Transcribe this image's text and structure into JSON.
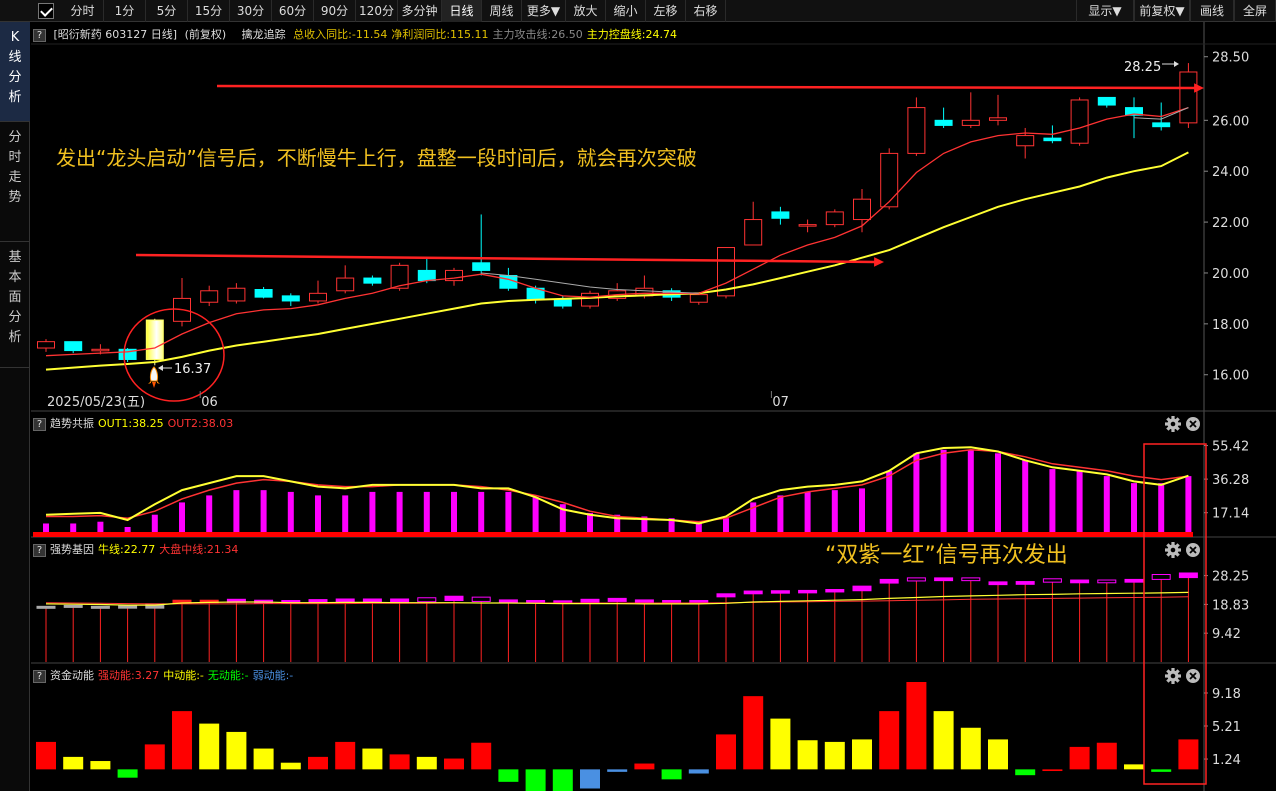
{
  "toolbar": {
    "checked": true,
    "buttons": [
      "分时",
      "1分",
      "5分",
      "15分",
      "30分",
      "60分",
      "90分",
      "120分",
      "多分钟",
      "日线",
      "周线",
      "更多▼",
      "放大",
      "缩小",
      "左移",
      "右移"
    ],
    "active": "日线",
    "right_buttons": [
      "显示▼",
      "前复权▼",
      "画线",
      "全屏"
    ]
  },
  "left_tabs": [
    {
      "label": "K线分析",
      "active": true
    },
    {
      "label": "分时走势",
      "active": false
    },
    {
      "label": "基本面分析",
      "active": false
    }
  ],
  "main_header": {
    "stock": "[昭衍新药 603127 日线]",
    "adj": "(前复权)",
    "indicator": "擒龙追踪",
    "items": [
      {
        "text": "总收入同比:-11.54",
        "color": "#e0c000"
      },
      {
        "text": "净利润同比:115.11",
        "color": "#e0c000"
      },
      {
        "text": "主力攻击线:26.50",
        "color": "#888888"
      },
      {
        "text": "主力控盘线:24.74",
        "color": "#ffff00"
      }
    ]
  },
  "annotations": {
    "main_text": "发出“龙头启动”信号后，不断慢牛上行，盘整一段时间后，就会再次突破",
    "sub_text": "“双紫一红”信号再次发出",
    "low_label": "16.37",
    "high_label": "28.25"
  },
  "x_labels": [
    {
      "text": "2025/05/23(五)",
      "index": 0
    },
    {
      "text": "06",
      "index": 6
    },
    {
      "text": "07",
      "index": 27
    }
  ],
  "colors": {
    "up": "#ff3333",
    "down": "#00ffff",
    "ma_fast": "#ff3333",
    "ma_slow": "#ffff33",
    "ma_mid": "#aaaaaa",
    "magenta": "#ff00ff",
    "red": "#ff0000",
    "yellow": "#ffff00",
    "green": "#00ff00",
    "blue": "#4a90e2"
  },
  "chart_data": [
    {
      "type": "candlestick",
      "title": "擒龙追踪",
      "ylim": [
        15.4,
        29.0
      ],
      "y_ticks": [
        16.0,
        18.0,
        20.0,
        22.0,
        24.0,
        26.0,
        28.5
      ],
      "y_tick_labels": [
        "16.00",
        "18.00",
        "20.00",
        "22.00",
        "24.00",
        "26.00",
        "28.50"
      ],
      "candles": [
        {
          "o": 17.05,
          "h": 17.4,
          "l": 16.9,
          "c": 17.3
        },
        {
          "o": 17.3,
          "h": 17.3,
          "l": 16.85,
          "c": 16.95
        },
        {
          "o": 16.95,
          "h": 17.2,
          "l": 16.8,
          "c": 17.0
        },
        {
          "o": 17.0,
          "h": 17.05,
          "l": 16.5,
          "c": 16.6
        },
        {
          "o": 16.6,
          "h": 18.2,
          "l": 16.37,
          "c": 18.15,
          "signal": true
        },
        {
          "o": 18.1,
          "h": 19.8,
          "l": 17.9,
          "c": 19.0
        },
        {
          "o": 18.85,
          "h": 19.5,
          "l": 18.7,
          "c": 19.3
        },
        {
          "o": 18.9,
          "h": 19.6,
          "l": 18.8,
          "c": 19.4
        },
        {
          "o": 19.35,
          "h": 19.45,
          "l": 19.0,
          "c": 19.05
        },
        {
          "o": 19.1,
          "h": 19.2,
          "l": 18.7,
          "c": 18.9
        },
        {
          "o": 18.9,
          "h": 19.7,
          "l": 18.8,
          "c": 19.2
        },
        {
          "o": 19.3,
          "h": 20.3,
          "l": 19.2,
          "c": 19.8
        },
        {
          "o": 19.8,
          "h": 19.9,
          "l": 19.5,
          "c": 19.6
        },
        {
          "o": 19.4,
          "h": 20.4,
          "l": 19.3,
          "c": 20.3
        },
        {
          "o": 20.1,
          "h": 20.6,
          "l": 19.6,
          "c": 19.7
        },
        {
          "o": 19.7,
          "h": 20.2,
          "l": 19.5,
          "c": 20.1
        },
        {
          "o": 20.4,
          "h": 22.3,
          "l": 19.9,
          "c": 20.1
        },
        {
          "o": 19.9,
          "h": 20.2,
          "l": 19.3,
          "c": 19.4
        },
        {
          "o": 19.4,
          "h": 19.5,
          "l": 18.8,
          "c": 18.95
        },
        {
          "o": 18.95,
          "h": 19.1,
          "l": 18.6,
          "c": 18.7
        },
        {
          "o": 18.7,
          "h": 19.3,
          "l": 18.6,
          "c": 19.2
        },
        {
          "o": 19.0,
          "h": 19.6,
          "l": 18.9,
          "c": 19.3
        },
        {
          "o": 19.1,
          "h": 19.9,
          "l": 19.0,
          "c": 19.4
        },
        {
          "o": 19.3,
          "h": 19.4,
          "l": 18.9,
          "c": 19.05
        },
        {
          "o": 18.85,
          "h": 19.2,
          "l": 18.75,
          "c": 19.15
        },
        {
          "o": 19.1,
          "h": 21.0,
          "l": 19.0,
          "c": 21.0
        },
        {
          "o": 21.1,
          "h": 22.8,
          "l": 21.1,
          "c": 22.1
        },
        {
          "o": 22.4,
          "h": 22.6,
          "l": 21.9,
          "c": 22.15
        },
        {
          "o": 21.85,
          "h": 22.1,
          "l": 21.6,
          "c": 21.9
        },
        {
          "o": 21.9,
          "h": 22.5,
          "l": 21.8,
          "c": 22.4
        },
        {
          "o": 22.1,
          "h": 23.3,
          "l": 21.6,
          "c": 22.9
        },
        {
          "o": 22.6,
          "h": 24.9,
          "l": 22.5,
          "c": 24.7
        },
        {
          "o": 24.7,
          "h": 26.9,
          "l": 24.6,
          "c": 26.5
        },
        {
          "o": 26.0,
          "h": 26.5,
          "l": 25.7,
          "c": 25.8
        },
        {
          "o": 25.8,
          "h": 27.1,
          "l": 25.7,
          "c": 26.0
        },
        {
          "o": 26.0,
          "h": 27.0,
          "l": 25.8,
          "c": 26.1
        },
        {
          "o": 25.0,
          "h": 25.7,
          "l": 24.5,
          "c": 25.4
        },
        {
          "o": 25.3,
          "h": 25.8,
          "l": 25.1,
          "c": 25.2
        },
        {
          "o": 25.1,
          "h": 26.9,
          "l": 25.0,
          "c": 26.8
        },
        {
          "o": 26.9,
          "h": 26.9,
          "l": 26.5,
          "c": 26.6
        },
        {
          "o": 26.5,
          "h": 26.9,
          "l": 25.3,
          "c": 26.2
        },
        {
          "o": 25.9,
          "h": 26.7,
          "l": 25.6,
          "c": 25.75
        },
        {
          "o": 25.9,
          "h": 28.25,
          "l": 25.7,
          "c": 27.9
        }
      ],
      "ma_fast": [
        16.75,
        16.8,
        16.85,
        16.9,
        17.05,
        17.6,
        18.05,
        18.4,
        18.55,
        18.6,
        18.75,
        19.0,
        19.2,
        19.5,
        19.7,
        19.8,
        19.95,
        19.75,
        19.4,
        19.1,
        19.05,
        19.15,
        19.2,
        19.2,
        19.2,
        19.6,
        20.15,
        20.7,
        21.1,
        21.4,
        21.85,
        22.8,
        23.95,
        24.7,
        25.15,
        25.4,
        25.5,
        25.45,
        25.7,
        26.05,
        26.25,
        26.15,
        26.5
      ],
      "ma_slow": [
        16.2,
        16.28,
        16.36,
        16.42,
        16.5,
        16.7,
        16.95,
        17.15,
        17.3,
        17.45,
        17.6,
        17.8,
        18.0,
        18.2,
        18.4,
        18.6,
        18.8,
        18.9,
        18.95,
        18.98,
        19.02,
        19.08,
        19.12,
        19.16,
        19.2,
        19.35,
        19.55,
        19.8,
        20.05,
        20.3,
        20.6,
        20.9,
        21.35,
        21.8,
        22.2,
        22.6,
        22.9,
        23.15,
        23.4,
        23.75,
        24.0,
        24.2,
        24.74
      ],
      "ma_mid": [
        null,
        null,
        null,
        null,
        null,
        null,
        null,
        null,
        null,
        null,
        null,
        null,
        null,
        null,
        null,
        null,
        20.0,
        19.9,
        19.75,
        19.6,
        19.45,
        19.35,
        19.3,
        19.25,
        19.2,
        null,
        null,
        null,
        null,
        null,
        null,
        null,
        null,
        null,
        null,
        null,
        null,
        null,
        null,
        null,
        26.1,
        26.05,
        26.5
      ]
    },
    {
      "type": "bar",
      "title": "趋势共振",
      "legend": [
        {
          "name": "OUT1",
          "value": "38.25",
          "color": "#ffff00"
        },
        {
          "name": "OUT2",
          "value": "38.03",
          "color": "#ff3333"
        }
      ],
      "ylim": [
        5.0,
        62.0
      ],
      "y_ticks": [
        55.42,
        36.28,
        17.14
      ],
      "y_tick_labels": [
        "55.42",
        "36.28",
        "17.14"
      ],
      "values": [
        11,
        11,
        12,
        9,
        16,
        23,
        27,
        30,
        30,
        29,
        27,
        27,
        29,
        29,
        29,
        29,
        29,
        29,
        26,
        22,
        17,
        16,
        15,
        14,
        11,
        14,
        23,
        27,
        29,
        30,
        31,
        41,
        51,
        53,
        53,
        51,
        47,
        42,
        41,
        38,
        34,
        34,
        38
      ],
      "out1": [
        16,
        16.5,
        17,
        13,
        22,
        30,
        34,
        38,
        38,
        35,
        32,
        31,
        33,
        33,
        33,
        33,
        31,
        31,
        26,
        19,
        16,
        14,
        13.5,
        13,
        11,
        15,
        25,
        30,
        32,
        33,
        35,
        41,
        51,
        54,
        54.5,
        52,
        47,
        43,
        41,
        39,
        35,
        33,
        38.25
      ],
      "out2": [
        15,
        15,
        15.5,
        14,
        18,
        25,
        30,
        34,
        36,
        35,
        33,
        32,
        32,
        33,
        33,
        33,
        32,
        30,
        27,
        23,
        18,
        15,
        14,
        13,
        12,
        14,
        20,
        26,
        29,
        31,
        33,
        38,
        47,
        51,
        53,
        52,
        49,
        45,
        43,
        41,
        38,
        36,
        38.03
      ]
    },
    {
      "type": "bar",
      "title": "强势基因",
      "legend": [
        {
          "name": "牛线",
          "value": "22.77",
          "color": "#ffff00"
        },
        {
          "name": "大盘中线",
          "value": "21.34",
          "color": "#ff3333"
        }
      ],
      "ylim": [
        0.0,
        34.0
      ],
      "y_ticks": [
        28.25,
        18.83,
        9.42
      ],
      "y_tick_labels": [
        "28.25",
        "18.83",
        "9.42"
      ],
      "box_hi": [
        18.2,
        18.5,
        18.2,
        18.4,
        19.0,
        20.2,
        20.2,
        20.5,
        20.2,
        20.1,
        20.4,
        20.6,
        20.6,
        20.6,
        21.0,
        21.5,
        21.2,
        20.3,
        20.1,
        20.0,
        20.5,
        20.8,
        20.3,
        20.1,
        20.1,
        22.3,
        23.2,
        23.3,
        23.4,
        23.7,
        24.8,
        27.0,
        27.5,
        27.5,
        27.5,
        26.2,
        26.3,
        27.2,
        26.8,
        26.8,
        27.0,
        28.6,
        29.1
      ],
      "box_lo": [
        17.7,
        17.9,
        17.7,
        17.6,
        17.6,
        19.2,
        19.4,
        19.5,
        19.3,
        19.2,
        19.4,
        19.6,
        19.6,
        19.6,
        19.7,
        20.1,
        19.8,
        19.4,
        19.4,
        19.3,
        19.6,
        19.8,
        19.4,
        19.3,
        19.3,
        21.3,
        22.3,
        22.5,
        22.6,
        22.9,
        23.3,
        25.8,
        26.5,
        26.6,
        26.6,
        25.3,
        25.4,
        26.1,
        25.9,
        25.9,
        26.1,
        27.0,
        27.6
      ],
      "box_color": [
        "#aaaaaa",
        "#aaaaaa",
        "#aaaaaa",
        "#aaaaaa",
        "#aaaaaa",
        "#ff2222",
        "#ff2222",
        "#ff00ff",
        "#ff00ff",
        "#ff00ff",
        "#ff00ff",
        "#ff00ff",
        "#ff00ff",
        "#ff00ff",
        "#ff00ff",
        "#ff00ff",
        "#ff00ff",
        "#ff00ff",
        "#ff00ff",
        "#ff00ff",
        "#ff00ff",
        "#ff00ff",
        "#ff00ff",
        "#ff00ff",
        "#ff00ff",
        "#ff00ff",
        "#ff00ff",
        "#ff00ff",
        "#ff00ff",
        "#ff00ff",
        "#ff00ff",
        "#ff00ff",
        "#ff00ff",
        "#ff00ff",
        "#ff00ff",
        "#ff00ff",
        "#ff00ff",
        "#ff00ff",
        "#ff00ff",
        "#ff00ff",
        "#ff00ff",
        "#ff00ff",
        "#ff00ff"
      ],
      "box_filled": [
        true,
        true,
        true,
        true,
        true,
        true,
        true,
        true,
        true,
        true,
        true,
        true,
        true,
        true,
        false,
        true,
        false,
        true,
        true,
        true,
        true,
        true,
        true,
        true,
        true,
        true,
        true,
        true,
        true,
        true,
        true,
        true,
        false,
        true,
        false,
        true,
        true,
        false,
        true,
        false,
        true,
        false,
        true
      ],
      "line1": [
        19.0,
        18.9,
        18.8,
        18.6,
        18.6,
        19.3,
        19.5,
        19.6,
        19.6,
        19.4,
        19.4,
        19.5,
        19.5,
        19.4,
        19.4,
        19.4,
        19.3,
        19.3,
        19.2,
        19.1,
        19.1,
        19.1,
        19.0,
        19.0,
        19.0,
        19.2,
        19.6,
        19.8,
        20.0,
        20.2,
        20.4,
        20.8,
        21.1,
        21.4,
        21.6,
        21.8,
        22.0,
        22.1,
        22.3,
        22.4,
        22.5,
        22.6,
        22.77
      ],
      "line2": [
        19.4,
        19.3,
        19.2,
        19.1,
        19.0,
        19.0,
        19.0,
        19.0,
        19.1,
        19.1,
        19.1,
        19.1,
        19.2,
        19.2,
        19.2,
        19.3,
        19.3,
        19.3,
        19.3,
        19.3,
        19.3,
        19.3,
        19.3,
        19.3,
        19.3,
        19.4,
        19.5,
        19.6,
        19.7,
        19.8,
        19.9,
        20.0,
        20.2,
        20.3,
        20.5,
        20.6,
        20.7,
        20.8,
        20.9,
        21.0,
        21.1,
        21.2,
        21.34
      ]
    },
    {
      "type": "bar",
      "title": "资金动能",
      "legend": [
        {
          "name": "强动能",
          "value": "3.27",
          "color": "#ff3333"
        },
        {
          "name": "中动能",
          "value": "-",
          "color": "#ffff00"
        },
        {
          "name": "无动能",
          "value": "-",
          "color": "#00ff00"
        },
        {
          "name": "弱动能",
          "value": "-",
          "color": "#4a90e2"
        }
      ],
      "ylim": [
        -2.0,
        10.5
      ],
      "y_ticks": [
        9.18,
        5.21,
        1.24
      ],
      "y_tick_labels": [
        "9.18",
        "5.21",
        "1.24"
      ],
      "values": [
        3.3,
        1.5,
        1.0,
        -1.0,
        3.0,
        7.0,
        5.5,
        4.5,
        2.5,
        0.8,
        1.5,
        3.3,
        2.5,
        1.8,
        1.5,
        1.3,
        3.2,
        -1.5,
        -2.8,
        -3.0,
        -2.3,
        -0.3,
        0.7,
        -1.2,
        -0.5,
        4.2,
        8.8,
        6.1,
        3.5,
        3.3,
        3.6,
        7.0,
        10.5,
        7.0,
        5.0,
        3.6,
        -0.7,
        -0.2,
        2.7,
        3.2,
        0.6,
        -0.3,
        3.6
      ],
      "bar_colors": [
        "#ff0000",
        "#ffff00",
        "#ffff00",
        "#00ff00",
        "#ff0000",
        "#ff0000",
        "#ffff00",
        "#ffff00",
        "#ffff00",
        "#ffff00",
        "#ff0000",
        "#ff0000",
        "#ffff00",
        "#ff0000",
        "#ffff00",
        "#ff0000",
        "#ff0000",
        "#00ff00",
        "#00ff00",
        "#00ff00",
        "#4a90e2",
        "#4a90e2",
        "#ff0000",
        "#00ff00",
        "#4a90e2",
        "#ff0000",
        "#ff0000",
        "#ffff00",
        "#ffff00",
        "#ffff00",
        "#ffff00",
        "#ff0000",
        "#ff0000",
        "#ffff00",
        "#ffff00",
        "#ffff00",
        "#00ff00",
        "#ff0000",
        "#ff0000",
        "#ff0000",
        "#ffff00",
        "#00ff00",
        "#ff0000"
      ]
    }
  ]
}
